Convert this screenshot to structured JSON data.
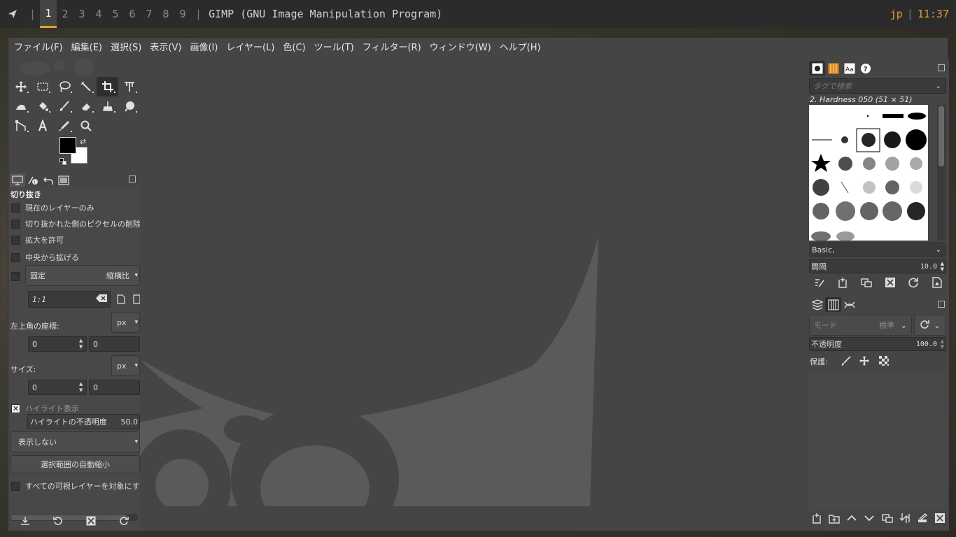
{
  "topbar": {
    "workspaces": [
      "1",
      "2",
      "3",
      "4",
      "5",
      "6",
      "7",
      "8",
      "9"
    ],
    "active_workspace": "1",
    "window_title": "GIMP (GNU Image Manipulation Program)",
    "lang": "jp",
    "clock": "11:37",
    "separator": "|",
    "accent": "#e0a030"
  },
  "menubar": {
    "items": [
      "ファイル(F)",
      "編集(E)",
      "選択(S)",
      "表示(V)",
      "画像(I)",
      "レイヤー(L)",
      "色(C)",
      "ツール(T)",
      "フィルター(R)",
      "ウィンドウ(W)",
      "ヘルプ(H)"
    ]
  },
  "toolbox": {
    "rows": [
      [
        "move-tool-icon",
        "rect-select-icon",
        "lasso-icon",
        "fuzzy-select-icon",
        "crop-icon",
        "unified-transform-icon"
      ],
      [
        "warp-icon",
        "bucket-fill-icon",
        "paintbrush-icon",
        "eraser-icon",
        "clone-icon",
        "smudge-icon"
      ],
      [
        "paths-icon",
        "text-icon",
        "color-picker-icon",
        "zoom-icon"
      ]
    ],
    "active_tool": "crop-icon",
    "fg_color": "#000000",
    "bg_color": "#ffffff"
  },
  "tool_options": {
    "title": "切り抜き",
    "current_layer_only": "現在のレイヤーのみ",
    "delete_cropped": "切り抜かれた側のピクセルの削除",
    "allow_growing": "拡大を許可",
    "expand_center": "中央から拡げる",
    "fixed_label": "固定",
    "fixed_mode": "縦横比",
    "ratio_value": "1:1",
    "position_label": "左上角の座標:",
    "position_unit": "px",
    "pos_x": "0",
    "pos_y": "0",
    "size_label": "サイズ:",
    "size_unit": "px",
    "size_w": "0",
    "size_h": "0",
    "highlight_label": "ハイライト表示",
    "highlight_opacity_label": "ハイライトの不透明度",
    "highlight_opacity_value": "50.0",
    "guides": "表示しない",
    "auto_shrink": "選択範囲の自動縮小",
    "all_visible": "すべての可視レイヤーを対象にする"
  },
  "brushes": {
    "tag_placeholder": "タグで検索",
    "selected_brush": "2. Hardness 050 (51 × 51)",
    "preset": "Basic,",
    "spacing_label": "間隔",
    "spacing_value": "10.0"
  },
  "layers": {
    "mode_label": "モード",
    "mode_value": "標準",
    "opacity_label": "不透明度",
    "opacity_value": "100.0",
    "lock_label": "保護:"
  }
}
